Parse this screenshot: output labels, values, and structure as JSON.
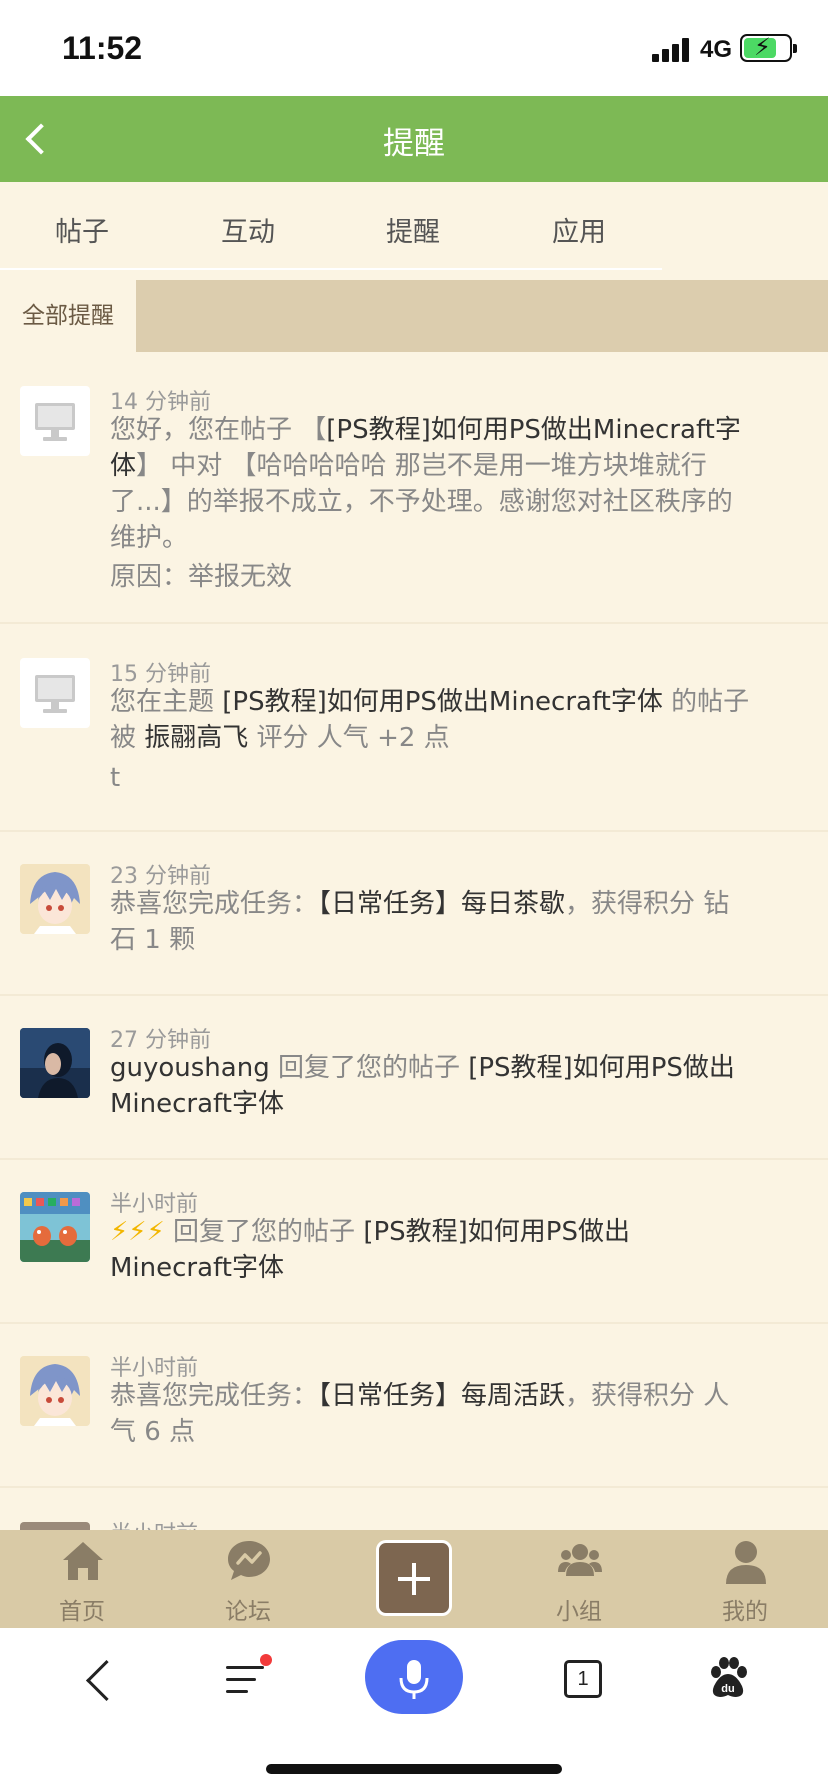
{
  "status_bar": {
    "time": "11:52",
    "network": "4G"
  },
  "header": {
    "title": "提醒"
  },
  "tabs": [
    {
      "label": "帖子"
    },
    {
      "label": "互动"
    },
    {
      "label": "提醒"
    },
    {
      "label": "应用"
    }
  ],
  "subtab": {
    "label": "全部提醒"
  },
  "notifications": [
    {
      "time": "14 分钟前",
      "line1a": "您好，您在帖子 【",
      "line1b": "[PS教程]如何用PS做出Minecraft字",
      "line2a": "体",
      "line2b": "】 中对 【哈哈哈哈哈 那岂不是用一堆方块堆就行",
      "line3": "了...】的举报不成立，不予处理。感谢您对社区秩序的",
      "line4": "维护。",
      "reason": "原因：举报无效"
    },
    {
      "time": "15 分钟前",
      "line1a": "您在主题 ",
      "line1b": "[PS教程]如何用PS做出Minecraft字体",
      "line1c": " 的帖子",
      "line2a": "被 ",
      "line2b": "振翮高飞",
      "line2c": " 评分 人气 +2 点",
      "line3": "t"
    },
    {
      "time": "23 分钟前",
      "line1a": "恭喜您完成任务：",
      "line1b": "【日常任务】每日茶歇",
      "line1c": "，获得积分 钻",
      "line2": "石 1 颗"
    },
    {
      "time": "27 分钟前",
      "line1a": "guyoushang",
      "line1b": " 回复了您的帖子 ",
      "line1c": "[PS教程]如何用PS做出",
      "line2": "Minecraft字体"
    },
    {
      "time": "半小时前",
      "line1a": "⚡⚡⚡",
      "line1b": " 回复了您的帖子 ",
      "line1c": "[PS教程]如何用PS做出",
      "line2": "Minecraft字体"
    },
    {
      "time": "半小时前",
      "line1a": "恭喜您完成任务：",
      "line1b": "【日常任务】每周活跃",
      "line1c": "，获得积分 人",
      "line2": "气 6 点"
    },
    {
      "time": "半小时前"
    }
  ],
  "bottom_nav": [
    {
      "label": "首页",
      "icon": "home-icon"
    },
    {
      "label": "论坛",
      "icon": "forum-icon"
    },
    {
      "label": "",
      "icon": "plus-icon"
    },
    {
      "label": "小组",
      "icon": "group-icon"
    },
    {
      "label": "我的",
      "icon": "profile-icon"
    }
  ],
  "browser_bar": {
    "tab_count": "1"
  },
  "colors": {
    "header_green": "#7db955",
    "page_bg": "#fbf4e3",
    "nav_bg": "#d9caa6",
    "mic_blue": "#4e6ef2"
  }
}
